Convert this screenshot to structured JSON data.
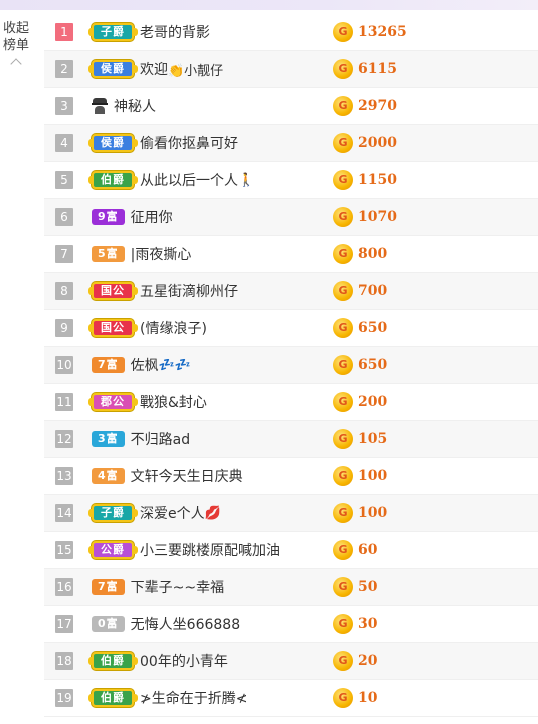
{
  "sidebar": {
    "collapse_line1": "收起",
    "collapse_line2": "榜单"
  },
  "coin_symbol": "G",
  "ranking": [
    {
      "rank": "1",
      "badge": "子爵",
      "badge_color": "#19a7a7",
      "badge_kind": "noble",
      "icon": "",
      "name": "老哥的背影",
      "suffix": "",
      "score": "13265"
    },
    {
      "rank": "2",
      "badge": "侯爵",
      "badge_color": "#3a7fe0",
      "badge_kind": "noble",
      "icon": "",
      "name": "欢迎",
      "suffix": "👏小靓仔",
      "score": "6115"
    },
    {
      "rank": "3",
      "badge": "",
      "badge_color": "",
      "badge_kind": "none",
      "icon": "mystery-icon",
      "name": "神秘人",
      "suffix": "",
      "score": "2970"
    },
    {
      "rank": "4",
      "badge": "侯爵",
      "badge_color": "#3a7fe0",
      "badge_kind": "noble",
      "icon": "",
      "name": "偷看你抠鼻可好",
      "suffix": "",
      "score": "2000"
    },
    {
      "rank": "5",
      "badge": "伯爵",
      "badge_color": "#3aa34a",
      "badge_kind": "noble",
      "icon": "",
      "name": "从此以后一个人",
      "suffix": "🚶",
      "score": "1150"
    },
    {
      "rank": "6",
      "badge": "9富",
      "badge_color": "#9b2fd8",
      "badge_kind": "rich",
      "icon": "",
      "name": "征用你",
      "suffix": "",
      "score": "1070"
    },
    {
      "rank": "7",
      "badge": "5富",
      "badge_color": "#f29a3e",
      "badge_kind": "rich",
      "icon": "",
      "name": "|雨夜撕心",
      "suffix": "",
      "score": "800"
    },
    {
      "rank": "8",
      "badge": "国公",
      "badge_color": "#e8334a",
      "badge_kind": "noble",
      "icon": "",
      "name": "五星街滴柳州仔",
      "suffix": "",
      "score": "700"
    },
    {
      "rank": "9",
      "badge": "国公",
      "badge_color": "#e8334a",
      "badge_kind": "noble",
      "icon": "",
      "name": "(情缘浪子)",
      "suffix": "",
      "score": "650"
    },
    {
      "rank": "10",
      "badge": "7富",
      "badge_color": "#f08a2e",
      "badge_kind": "rich",
      "icon": "",
      "name": "佐枫",
      "suffix": "💤💤",
      "score": "650"
    },
    {
      "rank": "11",
      "badge": "郡公",
      "badge_color": "#d94fb4",
      "badge_kind": "noble",
      "icon": "",
      "name": "戰狼&封心",
      "suffix": "",
      "score": "200"
    },
    {
      "rank": "12",
      "badge": "3富",
      "badge_color": "#2aa7d9",
      "badge_kind": "rich",
      "icon": "",
      "name": "不归路ad",
      "suffix": "",
      "score": "105"
    },
    {
      "rank": "13",
      "badge": "4富",
      "badge_color": "#f29a3e",
      "badge_kind": "rich",
      "icon": "",
      "name": "文轩今天生日庆典",
      "suffix": "",
      "score": "100"
    },
    {
      "rank": "14",
      "badge": "子爵",
      "badge_color": "#19a7a7",
      "badge_kind": "noble",
      "icon": "",
      "name": "深爱e个人",
      "suffix": "💋",
      "score": "100"
    },
    {
      "rank": "15",
      "badge": "公爵",
      "badge_color": "#b74fd6",
      "badge_kind": "noble",
      "icon": "",
      "name": "小三要跳楼原配喊加油",
      "suffix": "",
      "score": "60"
    },
    {
      "rank": "16",
      "badge": "7富",
      "badge_color": "#f08a2e",
      "badge_kind": "rich",
      "icon": "",
      "name": "下辈子~~幸福",
      "suffix": "",
      "score": "50"
    },
    {
      "rank": "17",
      "badge": "0富",
      "badge_color": "#b9b9b9",
      "badge_kind": "rich",
      "icon": "",
      "name": "无悔人坐666888",
      "suffix": "",
      "score": "30"
    },
    {
      "rank": "18",
      "badge": "伯爵",
      "badge_color": "#3aa34a",
      "badge_kind": "noble",
      "icon": "",
      "name": "00年的小青年",
      "suffix": "",
      "score": "20"
    },
    {
      "rank": "19",
      "badge": "伯爵",
      "badge_color": "#3aa34a",
      "badge_kind": "noble",
      "icon": "",
      "name": "≯生命在于折腾≮",
      "suffix": "",
      "score": "10"
    }
  ]
}
